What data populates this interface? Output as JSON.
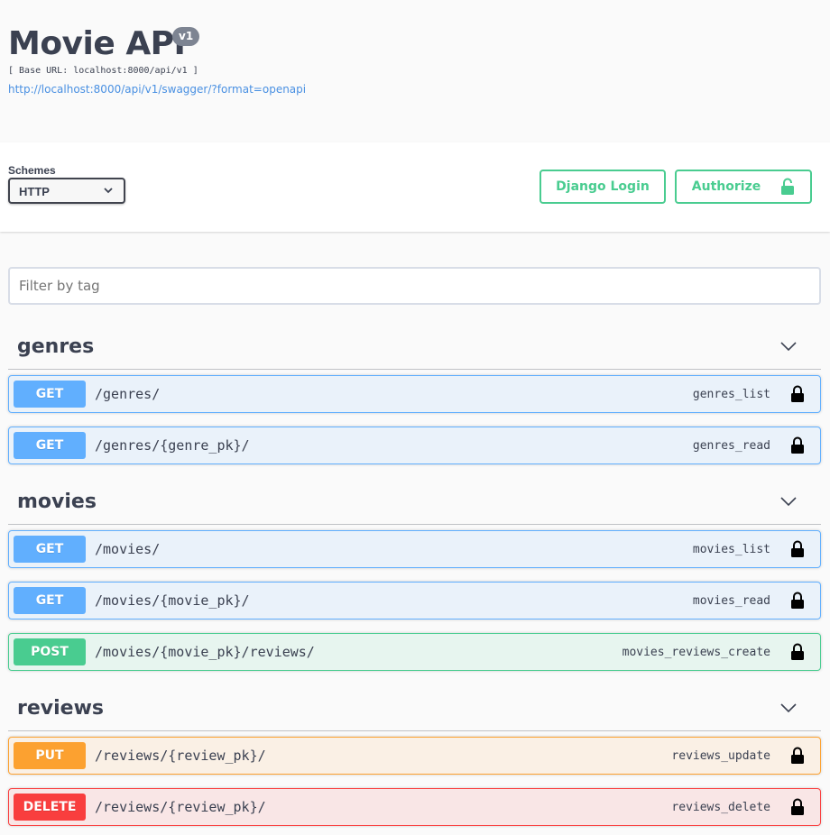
{
  "info": {
    "title": "Movie API",
    "version": "v1",
    "base_url": "[ Base URL: localhost:8000/api/v1 ]",
    "spec_link": "http://localhost:8000/api/v1/swagger/?format=openapi"
  },
  "schemes": {
    "label": "Schemes",
    "selected": "HTTP"
  },
  "buttons": {
    "django_login": "Django Login",
    "authorize": "Authorize"
  },
  "filter": {
    "placeholder": "Filter by tag"
  },
  "tags": [
    {
      "name": "genres",
      "operations": [
        {
          "method": "GET",
          "path": "/genres/",
          "operation_id": "genres_list"
        },
        {
          "method": "GET",
          "path": "/genres/{genre_pk}/",
          "operation_id": "genres_read"
        }
      ]
    },
    {
      "name": "movies",
      "operations": [
        {
          "method": "GET",
          "path": "/movies/",
          "operation_id": "movies_list"
        },
        {
          "method": "GET",
          "path": "/movies/{movie_pk}/",
          "operation_id": "movies_read"
        },
        {
          "method": "POST",
          "path": "/movies/{movie_pk}/reviews/",
          "operation_id": "movies_reviews_create"
        }
      ]
    },
    {
      "name": "reviews",
      "operations": [
        {
          "method": "PUT",
          "path": "/reviews/{review_pk}/",
          "operation_id": "reviews_update"
        },
        {
          "method": "DELETE",
          "path": "/reviews/{review_pk}/",
          "operation_id": "reviews_delete"
        }
      ]
    }
  ],
  "colors": {
    "get": "#61affe",
    "post": "#49cc90",
    "put": "#fca130",
    "delete": "#f93e3e",
    "authorize": "#49cc90"
  }
}
